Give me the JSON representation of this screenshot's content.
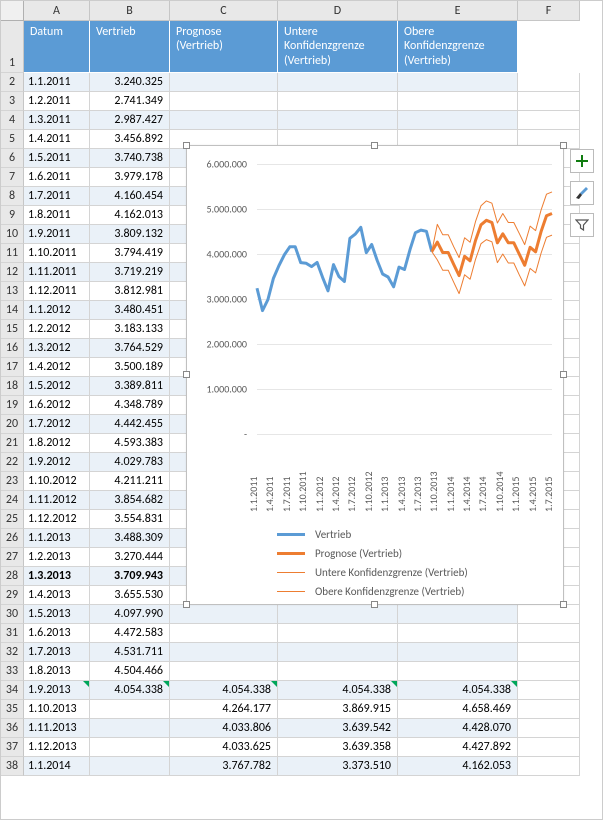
{
  "columns": [
    "A",
    "B",
    "C",
    "D",
    "E",
    "F"
  ],
  "headers": {
    "A": "Datum",
    "B": "Vertrieb",
    "C": "Prognose (Vertrieb)",
    "D": "Untere Konfidenzgrenze (Vertrieb)",
    "E": "Obere Konfidenzgrenze (Vertrieb)"
  },
  "rows": [
    {
      "n": 2,
      "a": "1.1.2011",
      "b": "3.240.325"
    },
    {
      "n": 3,
      "a": "1.2.2011",
      "b": "2.741.349"
    },
    {
      "n": 4,
      "a": "1.3.2011",
      "b": "2.987.427"
    },
    {
      "n": 5,
      "a": "1.4.2011",
      "b": "3.456.892"
    },
    {
      "n": 6,
      "a": "1.5.2011",
      "b": "3.740.738"
    },
    {
      "n": 7,
      "a": "1.6.2011",
      "b": "3.979.178"
    },
    {
      "n": 8,
      "a": "1.7.2011",
      "b": "4.160.454"
    },
    {
      "n": 9,
      "a": "1.8.2011",
      "b": "4.162.013"
    },
    {
      "n": 10,
      "a": "1.9.2011",
      "b": "3.809.132"
    },
    {
      "n": 11,
      "a": "1.10.2011",
      "b": "3.794.419"
    },
    {
      "n": 12,
      "a": "1.11.2011",
      "b": "3.719.219"
    },
    {
      "n": 13,
      "a": "1.12.2011",
      "b": "3.812.981"
    },
    {
      "n": 14,
      "a": "1.1.2012",
      "b": "3.480.451"
    },
    {
      "n": 15,
      "a": "1.2.2012",
      "b": "3.183.133"
    },
    {
      "n": 16,
      "a": "1.3.2012",
      "b": "3.764.529"
    },
    {
      "n": 17,
      "a": "1.4.2012",
      "b": "3.500.189"
    },
    {
      "n": 18,
      "a": "1.5.2012",
      "b": "3.389.811"
    },
    {
      "n": 19,
      "a": "1.6.2012",
      "b": "4.348.789"
    },
    {
      "n": 20,
      "a": "1.7.2012",
      "b": "4.442.455"
    },
    {
      "n": 21,
      "a": "1.8.2012",
      "b": "4.593.383"
    },
    {
      "n": 22,
      "a": "1.9.2012",
      "b": "4.029.783"
    },
    {
      "n": 23,
      "a": "1.10.2012",
      "b": "4.211.211"
    },
    {
      "n": 24,
      "a": "1.11.2012",
      "b": "3.854.682"
    },
    {
      "n": 25,
      "a": "1.12.2012",
      "b": "3.554.831"
    },
    {
      "n": 26,
      "a": "1.1.2013",
      "b": "3.488.309"
    },
    {
      "n": 27,
      "a": "1.2.2013",
      "b": "3.270.444"
    },
    {
      "n": 28,
      "a": "1.3.2013",
      "b": "3.709.943",
      "bold": true
    },
    {
      "n": 29,
      "a": "1.4.2013",
      "b": "3.655.530"
    },
    {
      "n": 30,
      "a": "1.5.2013",
      "b": "4.097.990"
    },
    {
      "n": 31,
      "a": "1.6.2013",
      "b": "4.472.583"
    },
    {
      "n": 32,
      "a": "1.7.2013",
      "b": "4.531.711"
    },
    {
      "n": 33,
      "a": "1.8.2013",
      "b": "4.504.466"
    },
    {
      "n": 34,
      "a": "1.9.2013",
      "b": "4.054.338",
      "c": "4.054.338",
      "d": "4.054.338",
      "e": "4.054.338",
      "flag": true
    },
    {
      "n": 35,
      "a": "1.10.2013",
      "b": "",
      "c": "4.264.177",
      "d": "3.869.915",
      "e": "4.658.469"
    },
    {
      "n": 36,
      "a": "1.11.2013",
      "b": "",
      "c": "4.033.806",
      "d": "3.639.542",
      "e": "4.428.070"
    },
    {
      "n": 37,
      "a": "1.12.2013",
      "b": "",
      "c": "4.033.625",
      "d": "3.639.358",
      "e": "4.427.892"
    },
    {
      "n": 38,
      "a": "1.1.2014",
      "b": "",
      "c": "3.767.782",
      "d": "3.373.510",
      "e": "4.162.053"
    }
  ],
  "chart_data": {
    "type": "line",
    "title": "",
    "ylim": [
      0,
      6000000
    ],
    "y_ticks": [
      "-",
      "1.000.000",
      "2.000.000",
      "3.000.000",
      "4.000.000",
      "5.000.000",
      "6.000.000"
    ],
    "x_ticks": [
      "1.1.2011",
      "1.4.2011",
      "1.7.2011",
      "1.10.2011",
      "1.1.2012",
      "1.4.2012",
      "1.7.2012",
      "1.10.2012",
      "1.1.2013",
      "1.4.2013",
      "1.7.2013",
      "1.10.2013",
      "1.1.2014",
      "1.4.2014",
      "1.7.2014",
      "1.10.2014",
      "1.1.2015",
      "1.4.2015",
      "1.7.2015"
    ],
    "series": [
      {
        "name": "Vertrieb",
        "color": "#5b9bd5",
        "width": 3,
        "x_start_index": 0,
        "values": [
          3240325,
          2741349,
          2987427,
          3456892,
          3740738,
          3979178,
          4160454,
          4162013,
          3809132,
          3794419,
          3719219,
          3812981,
          3480451,
          3183133,
          3764529,
          3500189,
          3389811,
          4348789,
          4442455,
          4593383,
          4029783,
          4211211,
          3854682,
          3554831,
          3488309,
          3270444,
          3709943,
          3655530,
          4097990,
          4472583,
          4531711,
          4504466,
          4054338
        ]
      },
      {
        "name": "Prognose (Vertrieb)",
        "color": "#ed7d31",
        "width": 3,
        "x_start_index": 32,
        "values": [
          4054338,
          4264177,
          4033806,
          4033625,
          3767782,
          3520000,
          3950000,
          3850000,
          4300000,
          4650000,
          4750000,
          4700000,
          4250000,
          4450000,
          4250000,
          4250000,
          4000000,
          3750000,
          4150000,
          4050000,
          4500000,
          4850000,
          4900000
        ]
      },
      {
        "name": "Untere Konfidenzgrenze (Vertrieb)",
        "color": "#ed7d31",
        "width": 1,
        "x_start_index": 32,
        "values": [
          4054338,
          3869915,
          3639542,
          3639358,
          3373510,
          3120000,
          3540000,
          3440000,
          3880000,
          4230000,
          4320000,
          4270000,
          3810000,
          4000000,
          3800000,
          3800000,
          3540000,
          3290000,
          3680000,
          3580000,
          4020000,
          4370000,
          4420000
        ]
      },
      {
        "name": "Obere Konfidenzgrenze (Vertrieb)",
        "color": "#ed7d31",
        "width": 1,
        "x_start_index": 32,
        "values": [
          4054338,
          4658469,
          4428070,
          4427892,
          4162053,
          3920000,
          4360000,
          4260000,
          4720000,
          5070000,
          5180000,
          5130000,
          4690000,
          4900000,
          4700000,
          4700000,
          4460000,
          4210000,
          4620000,
          4520000,
          4980000,
          5330000,
          5380000
        ]
      }
    ],
    "legend": [
      {
        "label": "Vertrieb",
        "color": "#5b9bd5",
        "width": 3
      },
      {
        "label": "Prognose (Vertrieb)",
        "color": "#ed7d31",
        "width": 3
      },
      {
        "label": "Untere Konfidenzgrenze (Vertrieb)",
        "color": "#ed7d31",
        "width": 1
      },
      {
        "label": "Obere Konfidenzgrenze (Vertrieb)",
        "color": "#ed7d31",
        "width": 1
      }
    ]
  },
  "tools": {
    "add": "+",
    "brush": "✎",
    "filter": "▼"
  }
}
